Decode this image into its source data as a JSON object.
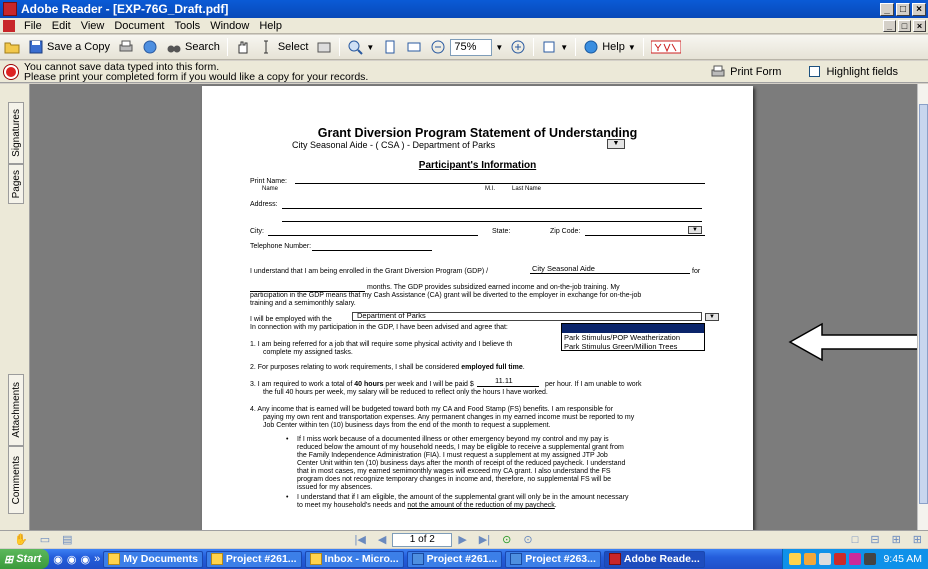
{
  "window": {
    "title": "Adobe Reader - [EXP-76G_Draft.pdf]",
    "buttons": [
      "_",
      "□",
      "×"
    ]
  },
  "menu": [
    "File",
    "Edit",
    "View",
    "Document",
    "Tools",
    "Window",
    "Help"
  ],
  "toolbar": {
    "save_copy": "Save a Copy",
    "search": "Search",
    "select": "Select",
    "zoom": "75%",
    "help": "Help"
  },
  "message": {
    "line1": "You cannot save data typed into this form.",
    "line2": "Please print your completed form if you would like a copy for your records.",
    "print_form": "Print Form",
    "highlight": "Highlight fields"
  },
  "sidetabs": {
    "signatures": "Signatures",
    "pages": "Pages",
    "attachments": "Attachments",
    "comments": "Comments"
  },
  "form": {
    "title": "Grant Diversion Program Statement of Understanding",
    "subtitle": "City Seasonal Aide - ( CSA ) - Department of Parks",
    "section": "Participant's Information",
    "print_name": "Print Name:",
    "name": "Name",
    "mi": "M.I.",
    "last_name": "Last Name",
    "address": "Address:",
    "city": "City:",
    "state": "State:",
    "zip": "Zip Code:",
    "telephone": "Telephone Number:",
    "para1_a": "I understand that I am being enrolled in the Grant Diversion Program (GDP) /",
    "para1_field": "City Seasonal Aide",
    "para1_for": "for",
    "para1_b": "months. The GDP provides subsidized earned income and on-the-job training. My",
    "para1_c": "participation in the GDP means that my Cash Assistance (CA) grant will be diverted to the employer in exchange for on-the-job",
    "para1_d": "training and a semimonthly salary.",
    "employed_with": "I will be employed with the",
    "employer_value": "Department of Parks",
    "in_connection": "In connection with my participation in the GDP, I have been advised and agree that:",
    "dropdown_options": [
      "",
      "Park Stimulus/POP Weatherization",
      "Park Stimulus Green/Million Trees"
    ],
    "item1_a": "1.  I am being referred for a job that will require some physical activity and I believe th",
    "item1_b": "complete my assigned tasks.",
    "item2": "2.  For purposes relating to work requirements, I shall be considered",
    "item2_bold": "employed full time",
    "item3_a": "3.  I am required to work a total of",
    "item3_bold": "40 hours",
    "item3_b": "per week and I will be paid $",
    "item3_pay": "11.11",
    "item3_c": "per hour. If I am unable to work",
    "item3_d": "the full 40 hours per week, my salary will be reduced to reflect only the hours I have worked.",
    "item4_a": "4.  Any income that is earned will be budgeted toward both my CA and Food Stamp (FS) benefits. I am responsible for",
    "item4_b": "paying my own rent and transportation expenses. Any permanent changes in my earned income must be reported to my",
    "item4_c": "Job Center within ten (10) business days from the end of the month to request a supplement.",
    "bullet1": [
      "If I miss work because of a documented illness or other emergency beyond my control and my pay is",
      "reduced below the amount of my household needs, I may be eligible to receive a supplemental grant from",
      "the Family Independence Administration (FIA). I must request a supplement at my assigned JTP Job",
      "Center Unit within ten (10) business days after the month of receipt of the reduced paycheck. I understand",
      "that in most cases, my earned semimonthly wages will exceed my CA grant. I also understand the FS",
      "program does not recognize temporary changes in income and, therefore, no supplemental FS will be",
      "issued for my absences."
    ],
    "bullet2_a": "I understand that if I am eligible, the amount of the supplemental grant will only be in the amount necessary",
    "bullet2_b": "to meet my household's needs and",
    "bullet2_u": "not the amount of the reduction of my paycheck"
  },
  "nav": {
    "page": "1 of 2"
  },
  "taskbar": {
    "start": "Start",
    "tasks": [
      "My Documents",
      "Project #261...",
      "Inbox - Micro...",
      "Project #261...",
      "Project #263...",
      "Adobe Reade..."
    ],
    "time": "9:45 AM"
  }
}
